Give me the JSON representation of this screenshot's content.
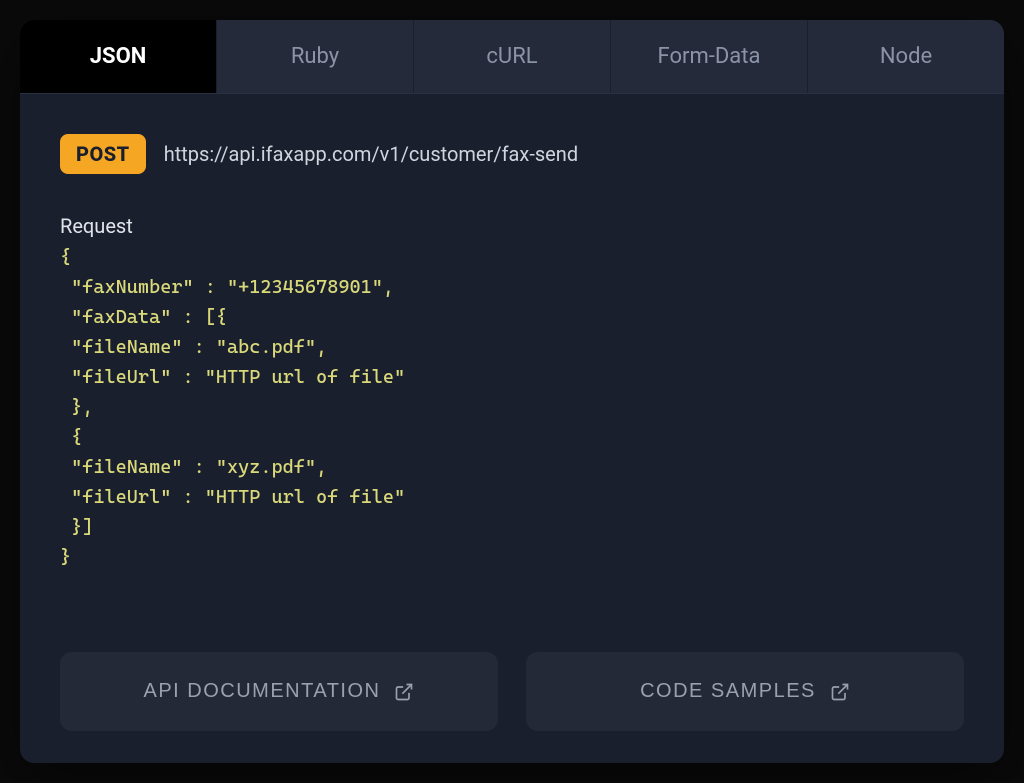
{
  "tabs": [
    {
      "label": "JSON",
      "active": true
    },
    {
      "label": "Ruby",
      "active": false
    },
    {
      "label": "cURL",
      "active": false
    },
    {
      "label": "Form-Data",
      "active": false
    },
    {
      "label": "Node",
      "active": false
    }
  ],
  "method": "POST",
  "url": "https://api.ifaxapp.com/v1/customer/fax-send",
  "request_label": "Request",
  "code": "{\n \"faxNumber\" : \"+12345678901\",\n \"faxData\" : [{\n \"fileName\" : \"abc.pdf\",\n \"fileUrl\" : \"HTTP url of file\"\n },\n {\n \"fileName\" : \"xyz.pdf\",\n \"fileUrl\" : \"HTTP url of file\"\n }]\n}",
  "buttons": {
    "api_docs": "API DOCUMENTATION",
    "code_samples": "CODE SAMPLES"
  }
}
